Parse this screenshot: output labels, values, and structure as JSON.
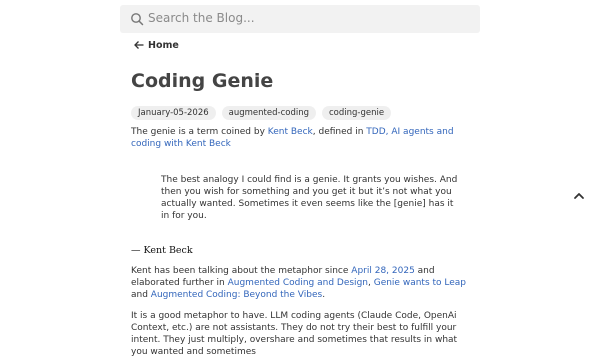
{
  "search": {
    "placeholder": "Search the Blog..."
  },
  "nav": {
    "home_label": "Home"
  },
  "post": {
    "title": "Coding Genie",
    "tags": [
      "January-05-2026",
      "augmented-coding",
      "coding-genie"
    ],
    "p1": {
      "t1": "The genie is a term coined by ",
      "link_kent": "Kent Beck",
      "t2": ", defined in ",
      "link_tdd": "TDD, AI agents and coding with Kent Beck"
    },
    "quote": "The best analogy I could find is a genie. It grants you wishes. And then you wish for something and you get it but it’s not what you actually wanted. Sometimes it even seems like the [genie] has it in for you.",
    "attribution": "— Kent Beck",
    "p2": {
      "t1": "Kent has been talking about the metaphor since ",
      "link_date": "April 28, 2025",
      "t2": " and elaborated further in ",
      "link_aug": "Augmented Coding and Design",
      "t3": ", ",
      "link_leap": "Genie wants to Leap",
      "t4": " and ",
      "link_vibes": "Augmented Coding: Beyond the Vibes",
      "t5": "."
    },
    "p3": "It is a good metaphor to have. LLM coding agents (Claude Code, OpenAi Context, etc.) are not assistants. They do not try their best to fulfill your intent. They just multiply, overshare and sometimes that results in what you wanted and sometimes"
  },
  "icons": {
    "search": "search-icon",
    "back": "arrow-left-icon",
    "scroll_top": "chevron-up-icon"
  }
}
